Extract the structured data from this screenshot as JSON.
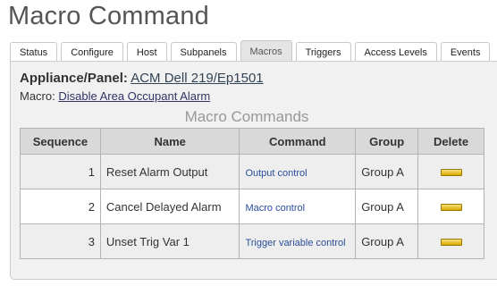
{
  "page": {
    "title": "Macro Command"
  },
  "tabs": [
    {
      "label": "Status",
      "active": false
    },
    {
      "label": "Configure",
      "active": false
    },
    {
      "label": "Host",
      "active": false
    },
    {
      "label": "Subpanels",
      "active": false
    },
    {
      "label": "Macros",
      "active": true
    },
    {
      "label": "Triggers",
      "active": false
    },
    {
      "label": "Access Levels",
      "active": false
    },
    {
      "label": "Events",
      "active": false
    }
  ],
  "details": {
    "appliance_label": "Appliance/Panel:",
    "appliance_value": "ACM Dell 219/Ep1501",
    "macro_label": "Macro:",
    "macro_value": "Disable Area Occupant Alarm"
  },
  "commands": {
    "title": "Macro Commands",
    "headers": [
      "Sequence",
      "Name",
      "Command",
      "Group",
      "Delete"
    ],
    "rows": [
      {
        "sequence": "1",
        "name": "Reset Alarm Output",
        "command": "Output control",
        "group": "Group A",
        "delete_icon": "delete-bar-icon"
      },
      {
        "sequence": "2",
        "name": "Cancel Delayed Alarm",
        "command": "Macro control",
        "group": "Group A",
        "delete_icon": "delete-bar-icon"
      },
      {
        "sequence": "3",
        "name": "Unset Trig Var 1",
        "command": "Trigger variable control",
        "group": "Group A",
        "delete_icon": "delete-bar-icon"
      }
    ]
  },
  "colors": {
    "active_tab_bg": "#e4e4e4",
    "panel_bg": "#f1f1f1",
    "header_bg": "#d9d9d9",
    "command_link": "#2a4e9a",
    "delete_icon": "#e8c020"
  }
}
